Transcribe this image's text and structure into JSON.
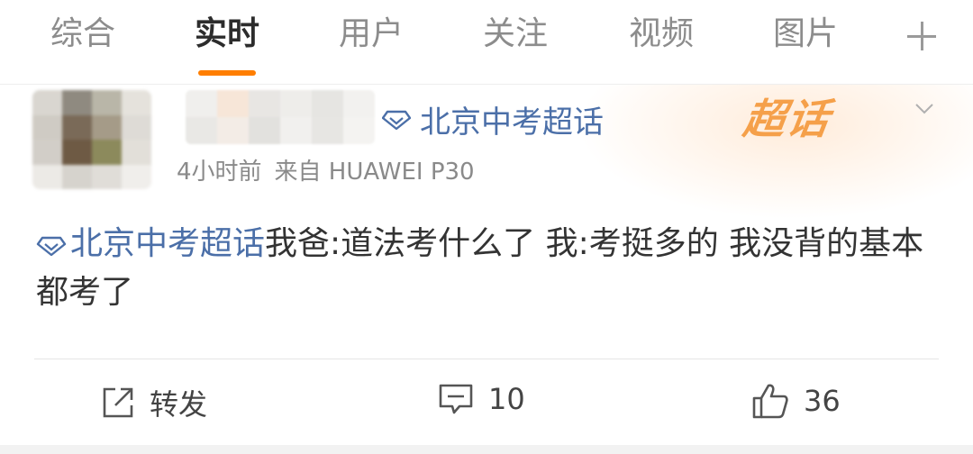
{
  "tabs": {
    "items": [
      "综合",
      "实时",
      "用户",
      "关注",
      "视频",
      "图片"
    ],
    "active": "实时"
  },
  "post": {
    "topic_badge": "北京中考超话",
    "banner_text": "超话",
    "time": "4小时前",
    "source": "来自 HUAWEI P30",
    "topic_inline": "北京中考超话",
    "text": "我爸:道法考什么了 我:考挺多的 我没背的基本都考了"
  },
  "actions": {
    "repost_label": "转发",
    "comment_count": "10",
    "like_count": "36"
  },
  "icons": {
    "add_tab": "plus-icon",
    "expand": "chevron-down-icon",
    "topic": "diamond-icon",
    "repost": "share-icon",
    "comment": "comment-icon",
    "like": "thumbs-up-icon"
  },
  "colors": {
    "accent": "#ff7e00",
    "link": "#4b6fa8",
    "banner": "#f5a04a"
  }
}
